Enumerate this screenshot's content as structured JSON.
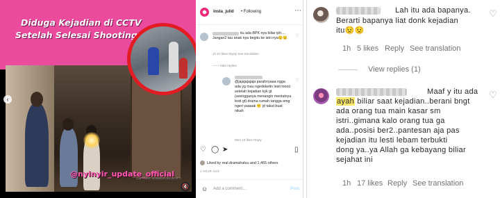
{
  "post": {
    "video": {
      "headline_line1": "Diduga Kejadian di CCTV",
      "headline_line2": "Setelah Selesai  Shooting ini",
      "watermark": "@nyinyir_update_official",
      "credit": "CAPTURE:NONADELAILALISTI",
      "prev_glyph": "‹",
      "mute_glyph": "🔇"
    },
    "header": {
      "username": "insta_julid",
      "follow_label": "• Following",
      "more_glyph": "⋯"
    },
    "comments": [
      {
        "text": "itu ada BPK nya biliar iph.... Jangan2 tau anak nya begitu ke istri nya😟😟",
        "meta": "1h   57 likes   Reply   See translation"
      },
      {
        "hide_replies": "—— Hide replies"
      },
      {
        "text": "@jajajajajaja parahnyaaa ngga ada yg mau ngedeketin lesti loooo setelah kejadian kyk gt (seengganya menangin mentalnya lesti gt) drama rumah tangga emg ngeri yaaaak 😕 jd takut buat nikah",
        "meta": "56m   19 likes   Reply"
      }
    ],
    "actions": {
      "like_glyph": "♡",
      "comment_glyph": "◯",
      "share_glyph": "➤",
      "save_glyph": "▯"
    },
    "liked_by": "Liked by real.dramahaluu and 1,465 others",
    "time_ago": "1 HOUR AGO",
    "add_comment": {
      "emoji_glyph": "☺",
      "placeholder": "Add a comment...",
      "post_label": "Post"
    }
  },
  "zoom": {
    "comment1": {
      "line1": "Lah itu ada bapanya.",
      "line2": "Berarti bapanya liat donk kejadian",
      "line3": "itu😟😟",
      "time": "1h",
      "likes": "5 likes",
      "reply": "Reply",
      "translate": "See translation"
    },
    "view_replies": "View replies (1)",
    "comment2": {
      "line1": "Maaf y itu ada",
      "line2_highlight": "ayah",
      "line2_rest": " biliar saat kejadian..berani bngt",
      "line3": "ada orang tua main kasar sm",
      "line4": "istri..gimana kalo orang tua ga",
      "line5": "ada..posisi ber2..pantesan aja pas",
      "line6": "kejadian itu lesti lebam terbukti",
      "line7": "dong ya..ya Allah ga kebayang biliar",
      "line8": "sejahat ini",
      "time": "1h",
      "likes": "17 likes",
      "reply": "Reply",
      "translate": "See translation"
    },
    "heart_glyph": "♡"
  }
}
